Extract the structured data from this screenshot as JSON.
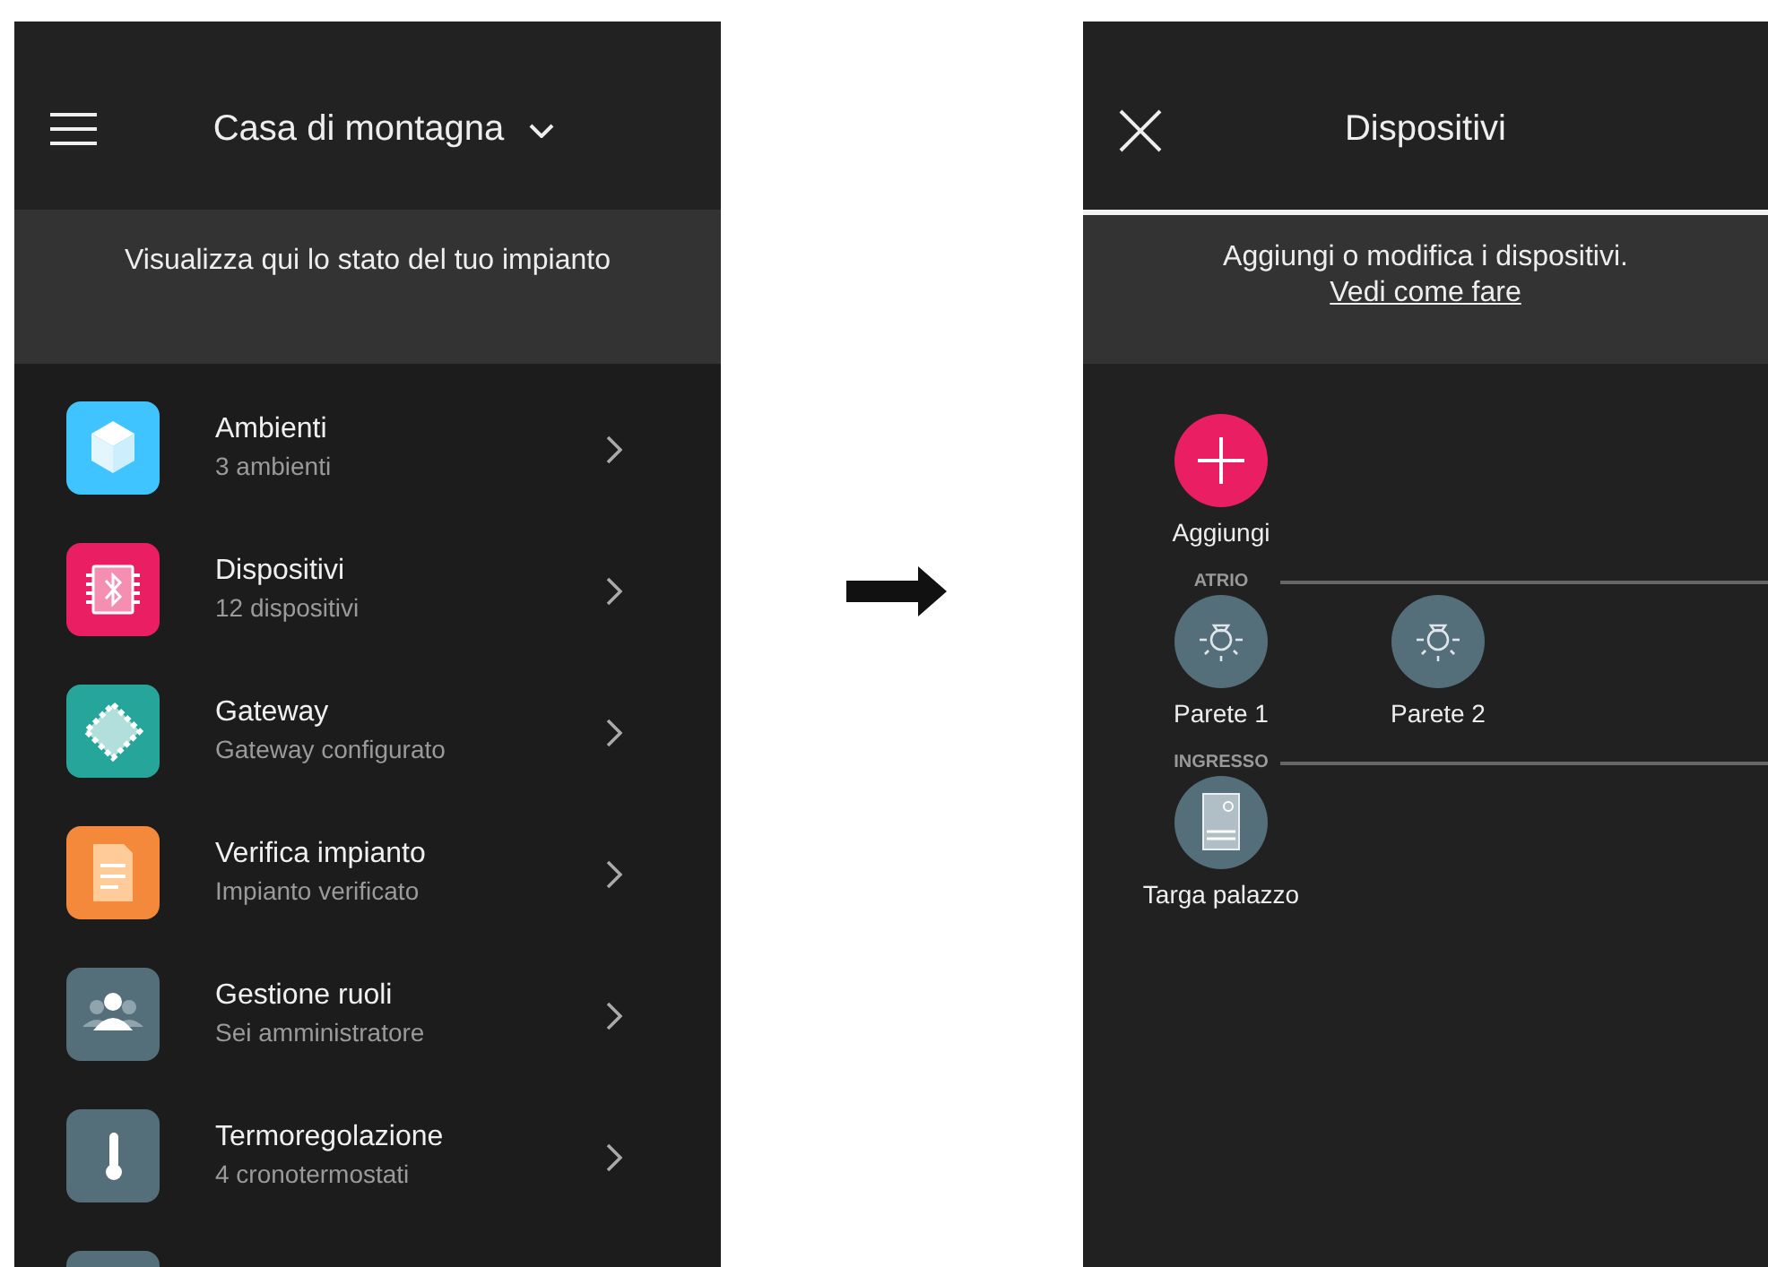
{
  "home_screen": {
    "header": {
      "title": "Casa di montagna"
    },
    "banner": "Visualizza qui lo stato del tuo impianto",
    "items": [
      {
        "kind": "cube",
        "color": "#40c4ff",
        "title": "Ambienti",
        "subtitle": "3 ambienti"
      },
      {
        "kind": "chip",
        "color": "#e91e63",
        "title": "Dispositivi",
        "subtitle": "12 dispositivi"
      },
      {
        "kind": "gateway",
        "color": "#26a69a",
        "title": "Gateway",
        "subtitle": "Gateway configurato"
      },
      {
        "kind": "document",
        "color": "#f5893b",
        "title": "Verifica impianto",
        "subtitle": "Impianto verificato"
      },
      {
        "kind": "people",
        "color": "#546e7a",
        "title": "Gestione ruoli",
        "subtitle": "Sei amministratore"
      },
      {
        "kind": "thermometer",
        "color": "#546e7a",
        "title": "Termoregolazione",
        "subtitle": "4 cronotermostati"
      },
      {
        "kind": "partial",
        "color": "#546e7a"
      }
    ]
  },
  "devices_screen": {
    "header": {
      "title": "Dispositivi"
    },
    "banner": {
      "text": "Aggiungi o modifica i dispositivi.",
      "link": "Vedi come fare"
    },
    "add_button": {
      "label": "Aggiungi"
    },
    "groups": [
      {
        "name": "ATRIO",
        "devices": [
          {
            "kind": "lamp",
            "name": "Parete 1"
          },
          {
            "kind": "lamp",
            "name": "Parete 2"
          }
        ]
      },
      {
        "name": "INGRESSO",
        "devices": [
          {
            "kind": "door-panel",
            "name": "Targa palazzo"
          }
        ]
      }
    ]
  }
}
